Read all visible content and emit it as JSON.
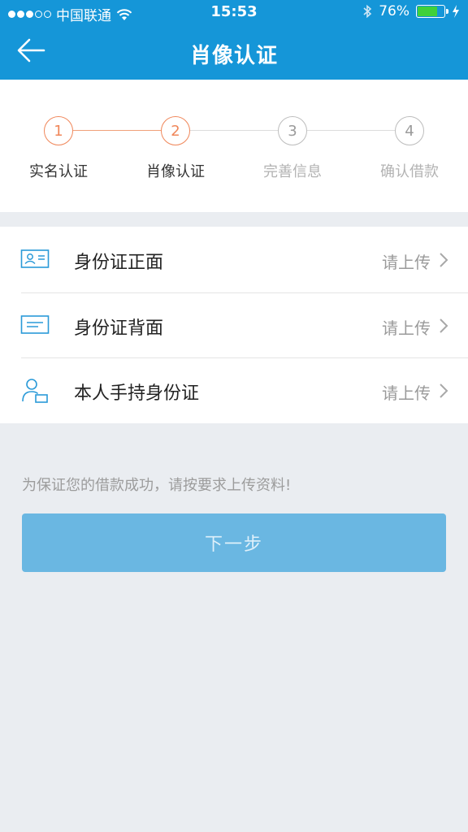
{
  "status_bar": {
    "carrier": "中国联通",
    "time": "15:53",
    "battery_percent": "76%",
    "battery_level": 0.76
  },
  "nav": {
    "title": "肖像认证",
    "back_icon": "arrow-left-icon"
  },
  "stepper": {
    "steps": [
      {
        "number": "1",
        "label": "实名认证",
        "active": true
      },
      {
        "number": "2",
        "label": "肖像认证",
        "active": true
      },
      {
        "number": "3",
        "label": "完善信息",
        "active": false
      },
      {
        "number": "4",
        "label": "确认借款",
        "active": false
      }
    ]
  },
  "uploads": [
    {
      "label": "身份证正面",
      "status": "请上传",
      "icon": "id-card-front-icon"
    },
    {
      "label": "身份证背面",
      "status": "请上传",
      "icon": "id-card-back-icon"
    },
    {
      "label": "本人手持身份证",
      "status": "请上传",
      "icon": "person-holding-id-icon"
    }
  ],
  "hint": "为保证您的借款成功，请按要求上传资料!",
  "next_button": "下一步",
  "colors": {
    "primary": "#1596d8",
    "active_step": "#f0875a",
    "button_disabled": "#6ab7e2"
  }
}
